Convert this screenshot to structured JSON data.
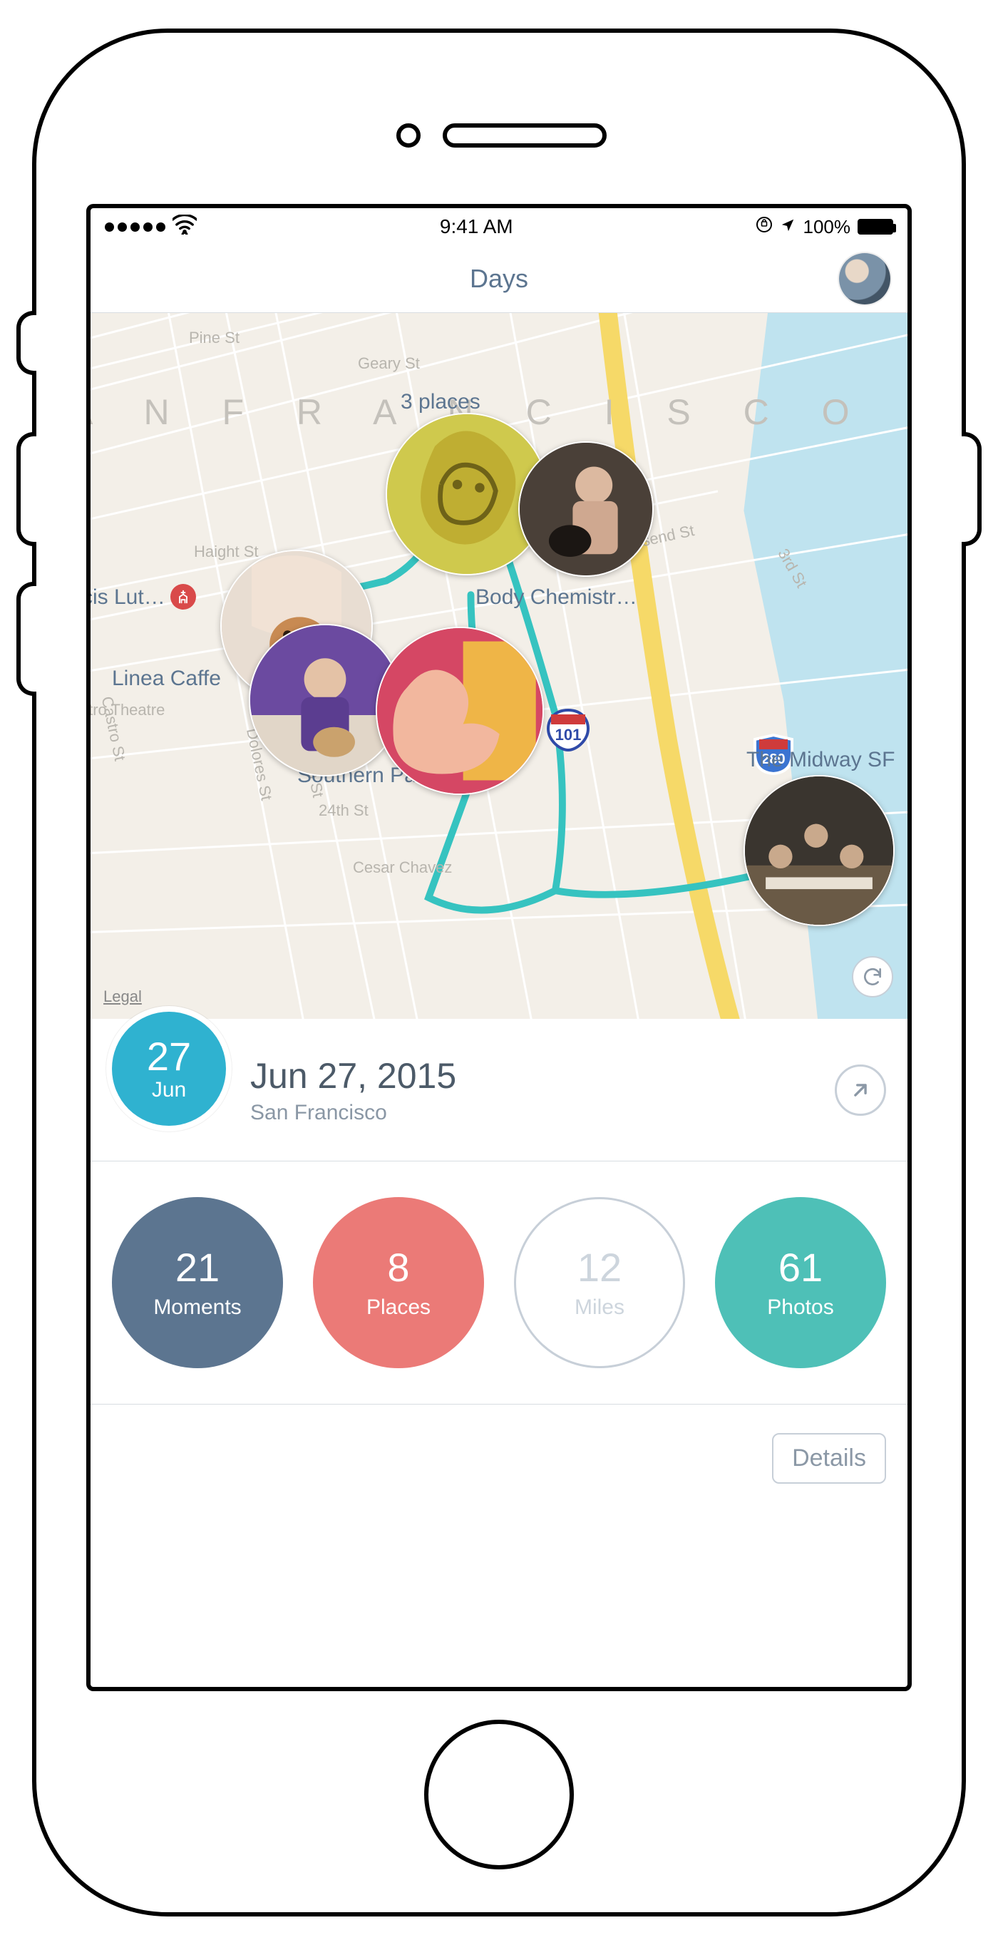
{
  "statusbar": {
    "time": "9:41 AM",
    "battery_percent": "100%"
  },
  "header": {
    "title": "Days"
  },
  "map": {
    "city_label": "A N   F R A N C I S C O",
    "legal": "Legal",
    "streets": {
      "pine": "Pine St",
      "geary": "Geary St",
      "haight": "Haight St",
      "townshend": "Townsend St",
      "third": "3rd St",
      "twentyfourth": "24th St",
      "cesar": "Cesar Chavez",
      "dolores": "Dolores St",
      "guerrero": "Guerrero St",
      "castro": "Castro St",
      "castrotheatre": "Castro Theatre"
    },
    "labels": {
      "cluster": "3 places",
      "cislut": "cis Lut…",
      "bodychem": "Body Chemistr…",
      "linea": "Linea Caffe",
      "southern": "Southern Pacif…",
      "midway": "The Midway SF"
    },
    "highways": {
      "h101": "101",
      "h280": "280"
    }
  },
  "day": {
    "badge_day": "27",
    "badge_month": "Jun",
    "date": "Jun 27, 2015",
    "city": "San Francisco"
  },
  "stats": [
    {
      "value": "21",
      "label": "Moments",
      "variant": "b1"
    },
    {
      "value": "8",
      "label": "Places",
      "variant": "b2"
    },
    {
      "value": "12",
      "label": "Miles",
      "variant": "hollow"
    },
    {
      "value": "61",
      "label": "Photos",
      "variant": "b4"
    }
  ],
  "actions": {
    "details": "Details"
  }
}
